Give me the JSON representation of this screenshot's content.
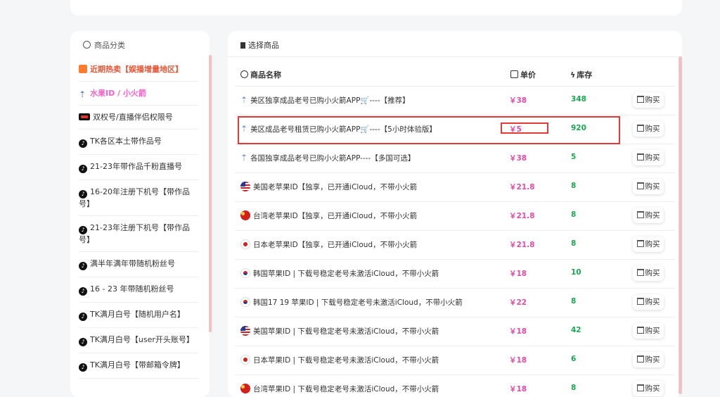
{
  "categories": {
    "title": "商品分类",
    "items": [
      {
        "label": "近期热卖【娱播增量地区】",
        "icon": "hot-badge-icon",
        "style": "hot"
      },
      {
        "label": "水果ID / 小火箭",
        "icon": "rocket-icon",
        "style": "pink"
      },
      {
        "label": "双权号/直播伴侣权限号",
        "icon": "live-badge-icon",
        "style": ""
      },
      {
        "label": "TK各区本土带作品号",
        "icon": "tiktok-icon",
        "style": ""
      },
      {
        "label": "21-23年带作品千粉直播号",
        "icon": "tiktok-icon",
        "style": ""
      },
      {
        "label": "16-20年注册下机号【带作品号】",
        "icon": "tiktok-icon",
        "style": ""
      },
      {
        "label": "21-23年注册下机号【带作品号】",
        "icon": "tiktok-icon",
        "style": ""
      },
      {
        "label": "满半年满年带随机粉丝号",
        "icon": "tiktok-icon",
        "style": ""
      },
      {
        "label": "16 - 23 年带随机粉丝号",
        "icon": "tiktok-icon",
        "style": ""
      },
      {
        "label": "TK满月白号【随机用户名】",
        "icon": "tiktok-icon",
        "style": ""
      },
      {
        "label": "TK满月白号【user开头账号】",
        "icon": "tiktok-icon",
        "style": ""
      },
      {
        "label": "TK满月白号【带邮箱令牌】",
        "icon": "tiktok-icon",
        "style": ""
      }
    ]
  },
  "products": {
    "title": "选择商品",
    "columns": {
      "name": "商品名称",
      "price": "单价",
      "stock": "库存"
    },
    "buy_label": "购买",
    "rows": [
      {
        "name": "美区独享成品老号已购小火箭APP🛒----【推荐】",
        "flag": "rocket",
        "price": "￥38",
        "stock": "348"
      },
      {
        "name": "美区成品老号租赁已购小火箭APP🛒----【5小时体验版】",
        "flag": "rocket",
        "price": "￥5",
        "stock": "920"
      },
      {
        "name": "各国独享成品老号已购小火箭APP----【多国可选】",
        "flag": "rocket",
        "price": "￥38",
        "stock": "5"
      },
      {
        "name": "美国老苹果ID【独享，已开通iCloud，不带小火箭",
        "flag": "us",
        "price": "￥21.8",
        "stock": "8"
      },
      {
        "name": "台湾老苹果ID【独享，已开通iCloud，不带小火箭",
        "flag": "tw",
        "price": "￥21.8",
        "stock": "8"
      },
      {
        "name": "日本老苹果ID【独享，已开通iCloud，不带小火箭",
        "flag": "jp",
        "price": "￥21.8",
        "stock": "8"
      },
      {
        "name": "韩国苹果ID | 下载号稳定老号未激活iCloud，不带小火箭",
        "flag": "kr",
        "price": "￥18",
        "stock": "10"
      },
      {
        "name": "韩国17 19 苹果ID | 下载号稳定老号未激活iCloud，不带小火箭",
        "flag": "kr",
        "price": "￥22",
        "stock": "8"
      },
      {
        "name": "美国苹果ID | 下载号稳定老号未激活iCloud，不带小火箭",
        "flag": "us",
        "price": "￥18",
        "stock": "42"
      },
      {
        "name": "日本苹果ID | 下载号稳定老号未激活iCloud，不带小火箭",
        "flag": "jp",
        "price": "￥18",
        "stock": "6"
      },
      {
        "name": "台湾苹果ID | 下载号稳定老号未激活iCloud，不带小火箭",
        "flag": "tw",
        "price": "￥18",
        "stock": "8"
      }
    ]
  }
}
